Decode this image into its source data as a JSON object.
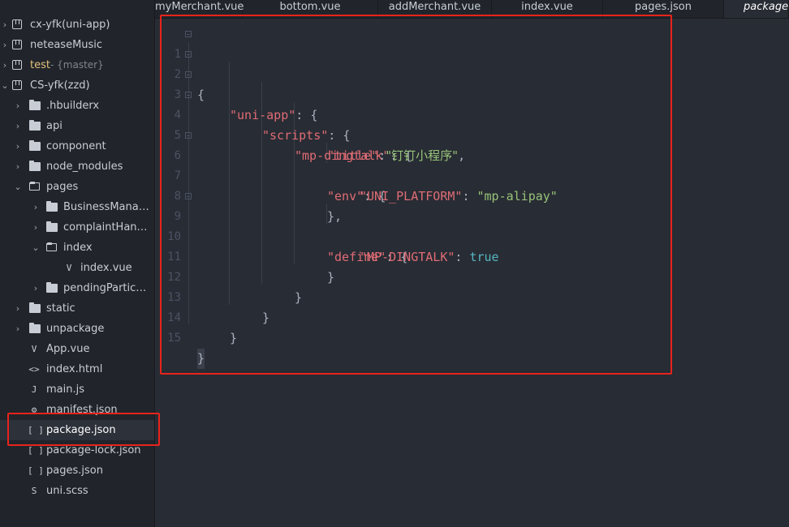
{
  "tabs": [
    {
      "label": "myMerchant.vue"
    },
    {
      "label": "bottom.vue"
    },
    {
      "label": "addMerchant.vue"
    },
    {
      "label": "index.vue"
    },
    {
      "label": "pages.json"
    },
    {
      "label": "package.j"
    }
  ],
  "sidebar": {
    "projects": [
      {
        "label": "cx-yfk(uni-app)"
      },
      {
        "label": "neteaseMusic"
      },
      {
        "label": "test",
        "branch": "- {master}"
      },
      {
        "label": "CS-yfk(zzd)"
      }
    ],
    "items": [
      {
        "label": ".hbuilderx"
      },
      {
        "label": "api"
      },
      {
        "label": "component"
      },
      {
        "label": "node_modules"
      },
      {
        "label": "pages"
      },
      {
        "label": "BusinessManag..."
      },
      {
        "label": "complaintHandli..."
      },
      {
        "label": "index"
      },
      {
        "label": "index.vue"
      },
      {
        "label": "pendingParticul..."
      },
      {
        "label": "static"
      },
      {
        "label": "unpackage"
      },
      {
        "label": "App.vue"
      },
      {
        "label": "index.html"
      },
      {
        "label": "main.js"
      },
      {
        "label": "manifest.json"
      },
      {
        "label": "package.json"
      },
      {
        "label": "package-lock.json"
      },
      {
        "label": "pages.json"
      },
      {
        "label": "uni.scss"
      }
    ],
    "glyphs": {
      "vue": "V",
      "html": "<>",
      "js": "J",
      "json": "[ ]",
      "manifest": "⚙",
      "scss": "S"
    }
  },
  "editor": {
    "line_numbers": [
      "1",
      "2",
      "3",
      "4",
      "5",
      "6",
      "7",
      "8",
      "9",
      "10",
      "11",
      "12",
      "13",
      "14",
      "15"
    ],
    "tokens": {
      "l1_open": "{",
      "l2_key": "\"uni-app\"",
      "l2_rest": ": {",
      "l3_key": "\"scripts\"",
      "l3_rest": ": {",
      "l4_key": "\"mp-dingtalk\"",
      "l4_rest": ": {",
      "l5_key": "\"title\"",
      "l5_colon": ":",
      "l5_val": "\"钉钉小程序\"",
      "l5_comma": ",",
      "l6_key": "\"env\"",
      "l6_rest": ": {",
      "l7_key": "\"UNI_PLATFORM\"",
      "l7_colon": ": ",
      "l7_val": "\"mp-alipay\"",
      "l8_close": "},",
      "l9_key": "\"define\"",
      "l9_rest": ": {",
      "l10_key": "\"MP-DINGTALK\"",
      "l10_colon": ": ",
      "l10_val": "true",
      "l11_close": "}",
      "l12_close": "}",
      "l13_close": "}",
      "l14_close": "}",
      "l15_close": "}"
    }
  },
  "colors": {
    "highlight": "#e8231b",
    "key": "#e06c75",
    "string": "#98c379",
    "boolean": "#56b6c2"
  }
}
